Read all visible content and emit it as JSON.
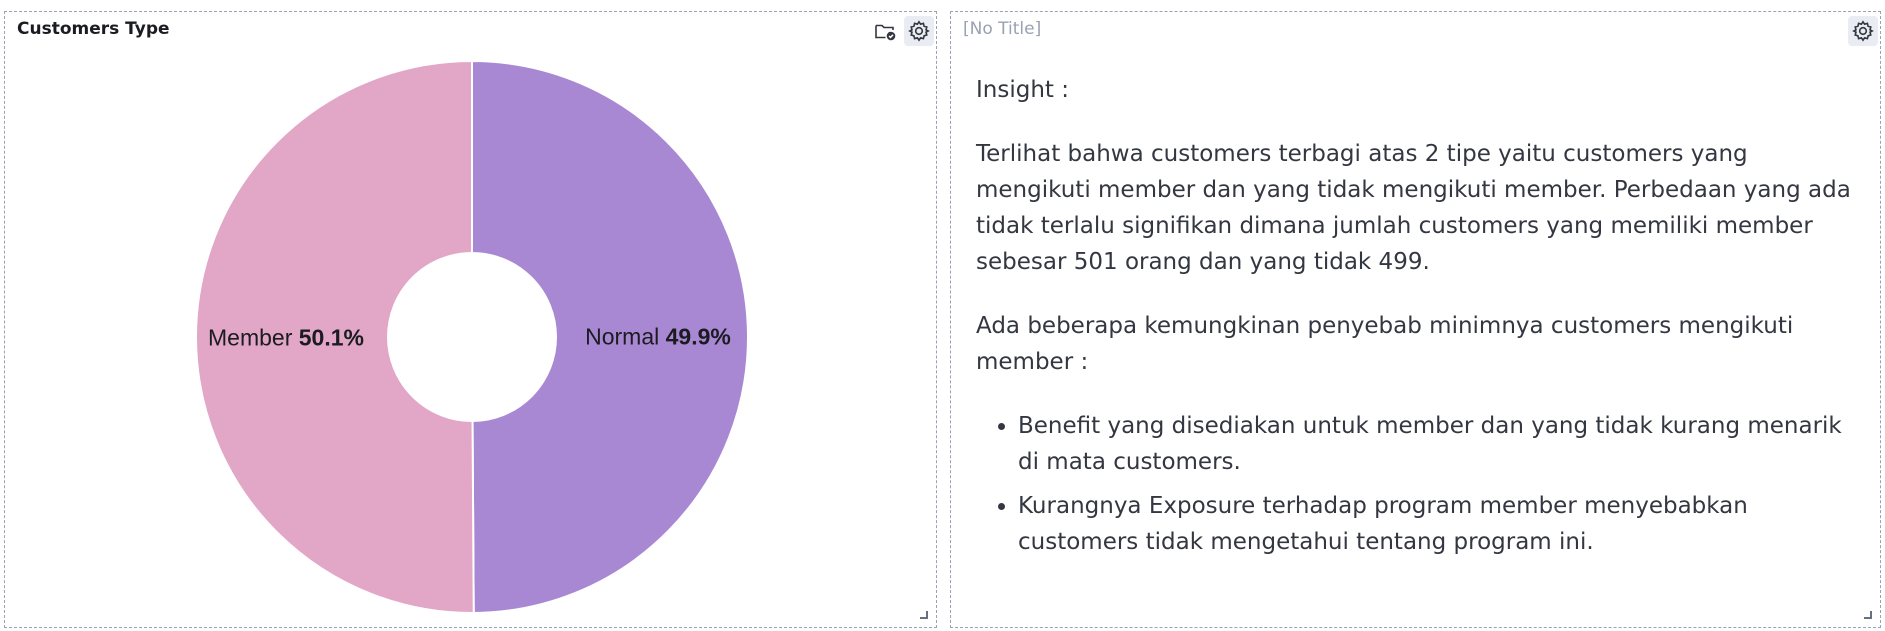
{
  "chart_panel": {
    "title": "Customers Type"
  },
  "chart_data": {
    "type": "pie",
    "donut": true,
    "title": "Customers Type",
    "slices": [
      {
        "label": "Normal",
        "percent_label": "49.9%",
        "value": 49.9,
        "color": "#a988d3"
      },
      {
        "label": "Member",
        "percent_label": "50.1%",
        "value": 50.1,
        "color": "#e2a6c6"
      }
    ]
  },
  "text_panel": {
    "title": "[No Title]",
    "heading": "Insight :",
    "paragraph1": "Terlihat bahwa customers terbagi atas 2 tipe yaitu customers yang mengikuti member dan yang tidak mengikuti member. Perbedaan yang ada tidak terlalu signifikan dimana jumlah customers yang memiliki member sebesar 501 orang dan yang tidak 499.",
    "paragraph2": "Ada beberapa kemungkinan penyebab minimnya customers mengikuti member :",
    "bullets": [
      "Benefit yang disediakan untuk member dan yang tidak kurang menarik di mata customers.",
      "Kurangnya Exposure terhadap program member menyebabkan customers tidak mengetahui tentang program ini."
    ]
  },
  "icons": {
    "folder_check": "folder-check-icon",
    "gear": "gear-icon"
  }
}
